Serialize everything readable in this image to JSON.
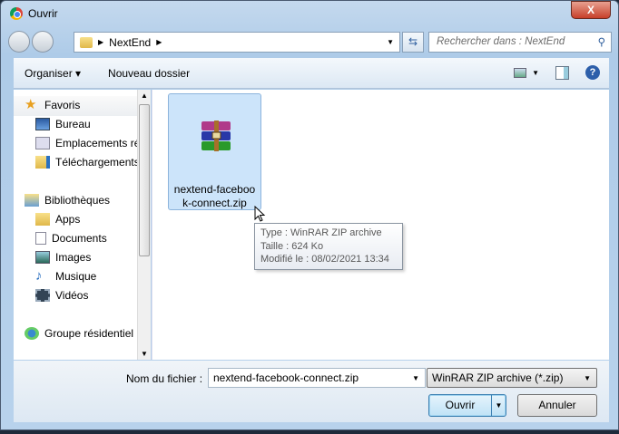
{
  "window": {
    "title": "Ouvrir",
    "close_label": "X"
  },
  "address": {
    "path": "NextEnd",
    "search_placeholder": "Rechercher dans : NextEnd"
  },
  "toolbar": {
    "organise": "Organiser ▾",
    "new_folder": "Nouveau dossier"
  },
  "sidebar": {
    "favorites": "Favoris",
    "fav_items": [
      "Bureau",
      "Emplacements récents",
      "Téléchargements"
    ],
    "libraries": "Bibliothèques",
    "lib_items": [
      "Apps",
      "Documents",
      "Images",
      "Musique",
      "Vidéos"
    ],
    "homegroup": "Groupe résidentiel"
  },
  "file": {
    "name": "nextend-facebook-connect.zip",
    "name_line1": "nextend-faceboo",
    "name_line2": "k-connect.zip"
  },
  "tooltip": {
    "type": "Type : WinRAR ZIP archive",
    "size": "Taille : 624 Ko",
    "modified": "Modifié le : 08/02/2021 13:34"
  },
  "footer": {
    "filename_label": "Nom du fichier :",
    "filename_value": "nextend-facebook-connect.zip",
    "filter": "WinRAR ZIP archive (*.zip)",
    "open": "Ouvrir",
    "cancel": "Annuler"
  }
}
